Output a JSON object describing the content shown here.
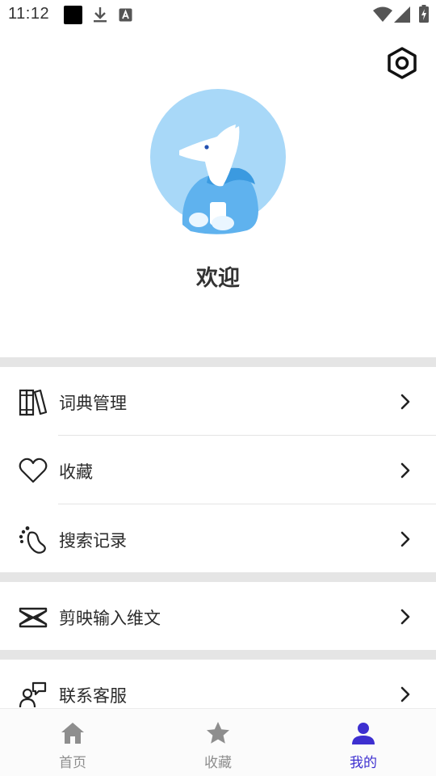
{
  "status_bar": {
    "time": "11:12",
    "icons": [
      "notification-square-icon",
      "download-icon",
      "a-letter-icon",
      "wifi-icon",
      "cell-signal-icon",
      "battery-charging-icon"
    ]
  },
  "header": {
    "settings_icon": "settings-hexagon-icon"
  },
  "profile": {
    "welcome_text": "欢迎",
    "avatar_bg": "#a8d8f8"
  },
  "menu": {
    "items": [
      {
        "label": "词典管理",
        "icon": "books-icon"
      },
      {
        "label": "收藏",
        "icon": "heart-outline-icon"
      },
      {
        "label": "搜索记录",
        "icon": "footprint-icon"
      },
      {
        "label": "剪映输入维文",
        "icon": "capcut-icon"
      },
      {
        "label": "联系客服",
        "icon": "customer-service-icon"
      }
    ]
  },
  "bottom_nav": {
    "items": [
      {
        "label": "首页",
        "icon": "home-icon",
        "active": false
      },
      {
        "label": "收藏",
        "icon": "star-icon",
        "active": false
      },
      {
        "label": "我的",
        "icon": "person-icon",
        "active": true
      }
    ],
    "active_color": "#3d2fd0",
    "inactive_color": "#8e8e8e"
  }
}
